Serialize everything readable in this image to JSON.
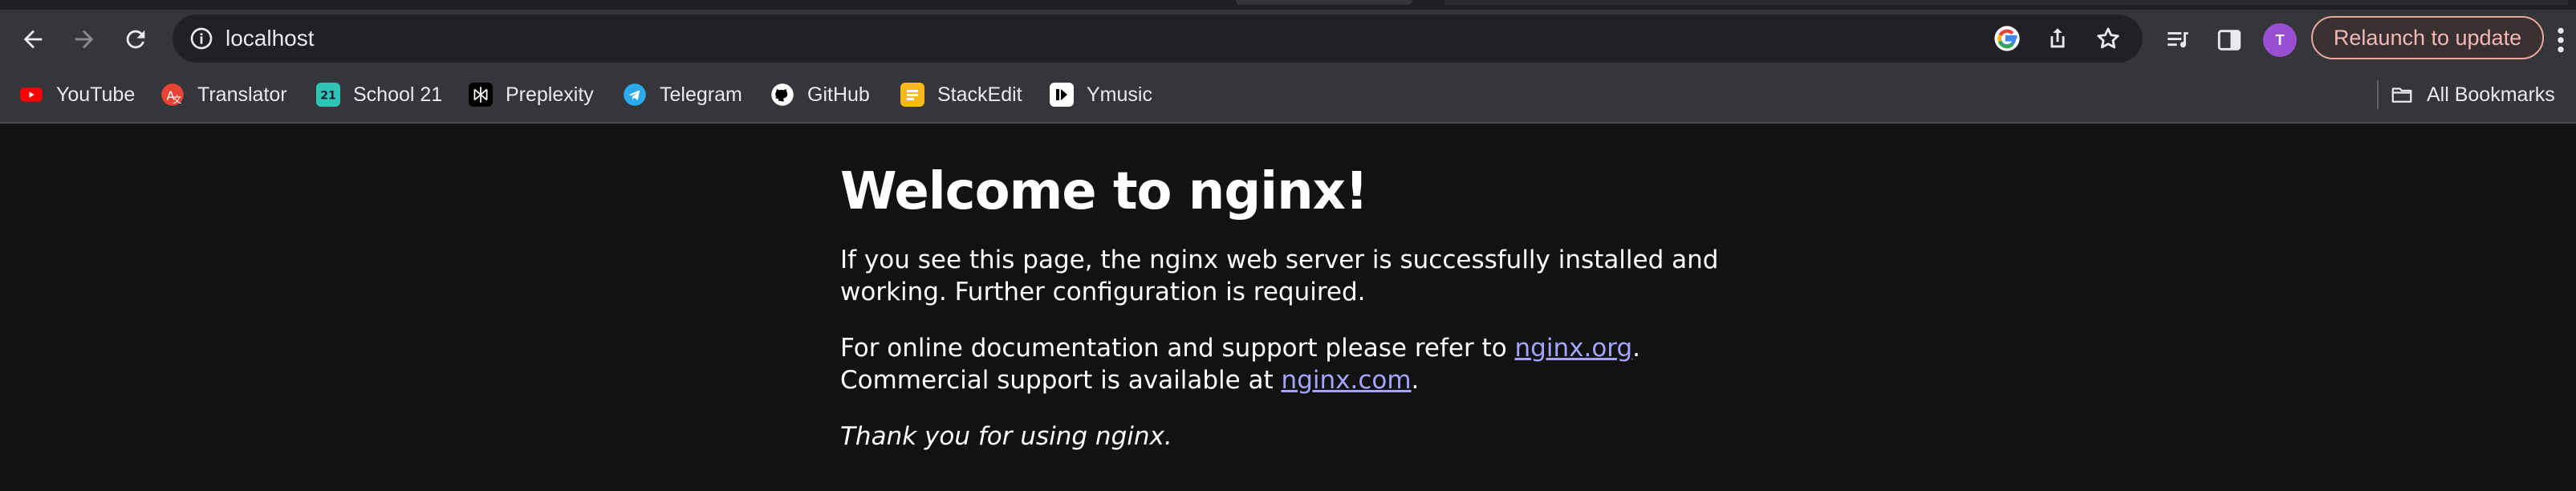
{
  "browser": {
    "url": "localhost",
    "relaunch_label": "Relaunch to update",
    "avatar_initial": "T",
    "bookmarks": [
      {
        "label": "YouTube",
        "icon": "youtube-icon",
        "color": "#ff0000"
      },
      {
        "label": "Translator",
        "icon": "translator-icon",
        "color": "#ea4335"
      },
      {
        "label": "School 21",
        "icon": "school21-icon",
        "color": "#2ec4b6"
      },
      {
        "label": "Preplexity",
        "icon": "perplexity-icon",
        "color": "#ffffff"
      },
      {
        "label": "Telegram",
        "icon": "telegram-icon",
        "color": "#2aabee"
      },
      {
        "label": "GitHub",
        "icon": "github-icon",
        "color": "#ffffff"
      },
      {
        "label": "StackEdit",
        "icon": "stackedit-icon",
        "color": "#f7b81b"
      },
      {
        "label": "Ymusic",
        "icon": "ymusic-icon",
        "color": "#ffffff"
      }
    ],
    "all_bookmarks_label": "All Bookmarks",
    "colors": {
      "toolbar": "#35363a",
      "omnibox": "#202124",
      "page_bg": "#121212",
      "link": "#a6a3ff"
    }
  },
  "page": {
    "heading": "Welcome to nginx!",
    "p1": "If you see this page, the nginx web server is successfully installed and working. Further configuration is required.",
    "p2_prefix": "For online documentation and support please refer to ",
    "p2_link1": "nginx.org",
    "p2_mid": ".",
    "p2_line2_prefix": "Commercial support is available at ",
    "p2_link2": "nginx.com",
    "p2_suffix": ".",
    "p3": "Thank you for using nginx."
  }
}
